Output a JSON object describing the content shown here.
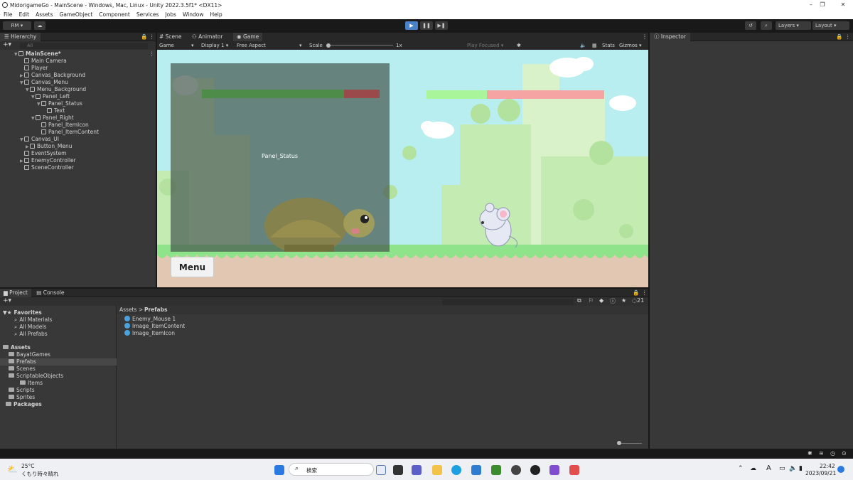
{
  "window": {
    "title": "MidorigameGo - MainScene - Windows, Mac, Linux - Unity 2022.3.5f1* <DX11>",
    "minimize": "–",
    "maximize": "❐",
    "close": "✕"
  },
  "menu": [
    "File",
    "Edit",
    "Assets",
    "GameObject",
    "Component",
    "Services",
    "Jobs",
    "Window",
    "Help"
  ],
  "toolbar": {
    "account": "RM ▾",
    "layers": "Layers",
    "layout": "Layout"
  },
  "hierarchy": {
    "tab": "Hierarchy",
    "search_placeholder": "All",
    "items": [
      {
        "label": "MainScene*",
        "depth": 0,
        "expand": "▼",
        "bold": true,
        "scene": true
      },
      {
        "label": "Main Camera",
        "depth": 1,
        "expand": ""
      },
      {
        "label": "Player",
        "depth": 1,
        "expand": ""
      },
      {
        "label": "Canvas_Background",
        "depth": 1,
        "expand": "▶"
      },
      {
        "label": "Canvas_Menu",
        "depth": 1,
        "expand": "▼"
      },
      {
        "label": "Menu_Background",
        "depth": 2,
        "expand": "▼"
      },
      {
        "label": "Panel_Left",
        "depth": 3,
        "expand": "▼"
      },
      {
        "label": "Panel_Status",
        "depth": 4,
        "expand": "▼"
      },
      {
        "label": "Text",
        "depth": 5,
        "expand": ""
      },
      {
        "label": "Panel_Right",
        "depth": 3,
        "expand": "▼"
      },
      {
        "label": "Panel_ItemIcon",
        "depth": 4,
        "expand": ""
      },
      {
        "label": "Panel_ItemContent",
        "depth": 4,
        "expand": ""
      },
      {
        "label": "Canvas_UI",
        "depth": 1,
        "expand": "▼"
      },
      {
        "label": "Button_Menu",
        "depth": 2,
        "expand": "▶"
      },
      {
        "label": "EventSystem",
        "depth": 1,
        "expand": ""
      },
      {
        "label": "EnemyController",
        "depth": 1,
        "expand": "▶"
      },
      {
        "label": "SceneController",
        "depth": 1,
        "expand": ""
      }
    ]
  },
  "tabs": {
    "scene": "Scene",
    "animator": "Animator",
    "game": "Game"
  },
  "gamebar": {
    "mode": "Game",
    "display": "Display 1",
    "aspect": "Free Aspect",
    "scale_label": "Scale",
    "scale_value": "1x",
    "play_focused": "Play Focused",
    "stats": "Stats",
    "gizmos": "Gizmos"
  },
  "game": {
    "panel_status_label": "Panel_Status",
    "menu_button": "Menu",
    "player_hp": 0.8,
    "enemy_hp": 0.34
  },
  "inspector": {
    "tab": "Inspector"
  },
  "project": {
    "tab_project": "Project",
    "tab_console": "Console",
    "hidden_count": "21",
    "breadcrumb": [
      "Assets",
      "Prefabs"
    ],
    "favorites": {
      "label": "Favorites",
      "items": [
        "All Materials",
        "All Models",
        "All Prefabs"
      ]
    },
    "assets": {
      "label": "Assets",
      "items": [
        {
          "label": "BayatGames",
          "depth": 1
        },
        {
          "label": "Prefabs",
          "depth": 1,
          "selected": true
        },
        {
          "label": "Scenes",
          "depth": 1
        },
        {
          "label": "ScriptableObjects",
          "depth": 1
        },
        {
          "label": "Items",
          "depth": 2
        },
        {
          "label": "Scripts",
          "depth": 1
        },
        {
          "label": "Sprites",
          "depth": 1
        }
      ]
    },
    "packages": "Packages",
    "files": [
      "Enemy_Mouse 1",
      "Image_ItemContent",
      "Image_ItemIcon"
    ]
  },
  "taskbar": {
    "temp": "25°C",
    "weather": "くもり時々晴れ",
    "search": "検索",
    "time": "22:42",
    "date": "2023/09/21",
    "ime": "A"
  },
  "colors": {
    "sky": "#b8eef0",
    "hp_green": "#a9f59a",
    "hp_red": "#f5a3a3",
    "panel": "rgba(70,90,80,0.72)"
  }
}
